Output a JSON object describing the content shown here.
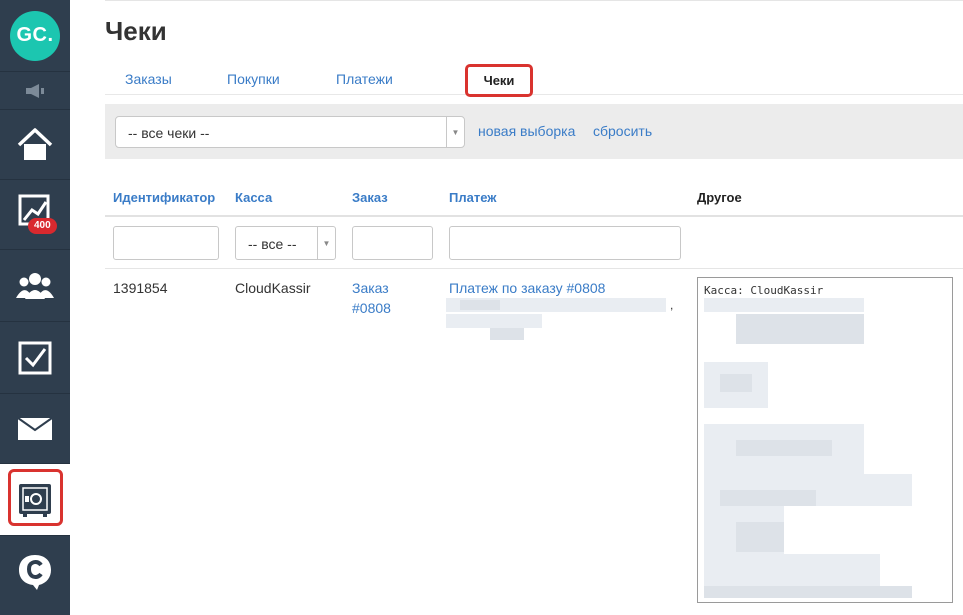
{
  "sidebar": {
    "logo_text": "GC.",
    "badge_count": "400",
    "icons": [
      "megaphone-icon",
      "home-icon",
      "chart-icon",
      "users-icon",
      "checkbox-icon",
      "mail-icon",
      "safe-icon",
      "chat-logo-icon"
    ],
    "accent_color": "#1cc6b0",
    "highlight_color": "#d9332f"
  },
  "page": {
    "title": "Чеки"
  },
  "tabs": [
    {
      "label": "Заказы"
    },
    {
      "label": "Покупки"
    },
    {
      "label": "Платежи"
    },
    {
      "label": "Чеки",
      "active": true
    }
  ],
  "filter_bar": {
    "select_value": "-- все чеки --",
    "new_selection_label": "новая выборка",
    "reset_label": "сбросить"
  },
  "table": {
    "headers": [
      "Идентификатор",
      "Касса",
      "Заказ",
      "Платеж",
      "Другое"
    ],
    "kassa_filter_value": "-- все --",
    "rows": [
      {
        "id": "1391854",
        "kassa": "CloudKassir",
        "order_line1": "Заказ",
        "order_line2": "#0808",
        "payment": "Платеж по заказу #0808",
        "payment_suffix": ",",
        "other_text": "Касса: CloudKassir"
      }
    ]
  }
}
